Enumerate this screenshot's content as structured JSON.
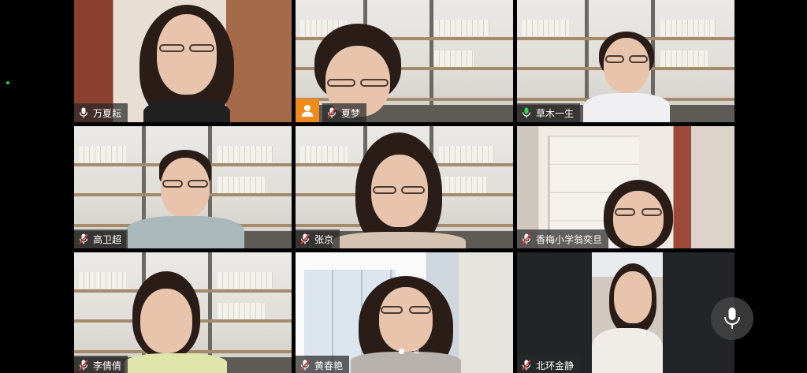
{
  "participants": [
    {
      "name": "万夏耘",
      "mic": "on",
      "active": true
    },
    {
      "name": "夏梦",
      "mic": "muted",
      "active": false
    },
    {
      "name": "草木一生",
      "mic": "on",
      "active": false
    },
    {
      "name": "高卫超",
      "mic": "muted",
      "active": false
    },
    {
      "name": "张京",
      "mic": "muted",
      "active": false
    },
    {
      "name": "香梅小学翁奕旦",
      "mic": "muted",
      "active": false
    },
    {
      "name": "李倩倩",
      "mic": "muted",
      "active": false
    },
    {
      "name": "黄春艳",
      "mic": "muted",
      "active": false
    },
    {
      "name": "北环金静",
      "mic": "muted",
      "active": false
    }
  ],
  "icons": {
    "mic_on": "microphone-icon",
    "mic_muted": "microphone-muted-icon",
    "avatar": "user-avatar-icon",
    "floating": "microphone-icon"
  },
  "pager": {
    "pages": 2,
    "current": 1
  },
  "colors": {
    "active_border": "#39d05a",
    "muted_red": "#e23b3b",
    "avatar_orange": "#f08a1a",
    "background": "#000000"
  }
}
